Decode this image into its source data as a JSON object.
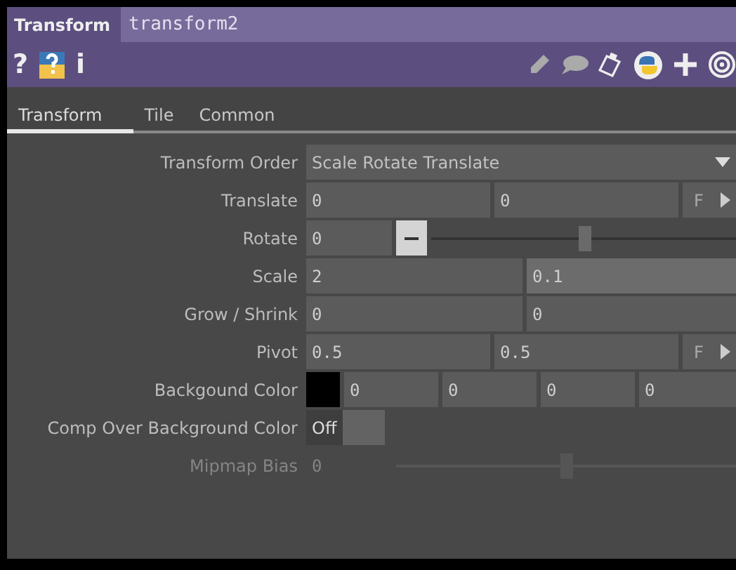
{
  "header": {
    "op_type": "Transform",
    "node_name": "transform2",
    "help_glyph": "?",
    "info_glyph": "i"
  },
  "tabs": [
    {
      "label": "Transform",
      "selected": true
    },
    {
      "label": "Tile",
      "selected": false
    },
    {
      "label": "Common",
      "selected": false
    }
  ],
  "params": [
    {
      "kind": "menu",
      "label": "Transform Order",
      "value": "Scale Rotate Translate",
      "disabled": false
    },
    {
      "kind": "fields",
      "label": "Translate",
      "values": [
        {
          "text": "0",
          "highlighted": false
        },
        {
          "text": "0",
          "highlighted": false
        }
      ],
      "extra": "F",
      "disabled": false
    },
    {
      "kind": "slider",
      "label": "Rotate",
      "value": "0",
      "level": 0.5,
      "disabled": false
    },
    {
      "kind": "fields",
      "label": "Scale",
      "values": [
        {
          "text": "2",
          "highlighted": false
        },
        {
          "text": "0.1",
          "highlighted": true
        }
      ],
      "disabled": false
    },
    {
      "kind": "fields",
      "label": "Grow / Shrink",
      "values": [
        {
          "text": "0",
          "highlighted": false
        },
        {
          "text": "0",
          "highlighted": false
        }
      ],
      "disabled": false
    },
    {
      "kind": "fields",
      "label": "Pivot",
      "values": [
        {
          "text": "0.5",
          "highlighted": false
        },
        {
          "text": "0.5",
          "highlighted": false
        }
      ],
      "extra": "F",
      "disabled": false
    },
    {
      "kind": "color",
      "label": "Backgound Color",
      "color": "#000000",
      "values": [
        {
          "text": "0",
          "highlighted": false
        },
        {
          "text": "0",
          "highlighted": false
        },
        {
          "text": "0",
          "highlighted": false
        },
        {
          "text": "0",
          "highlighted": false
        }
      ],
      "disabled": false
    },
    {
      "kind": "toggle",
      "label": "Comp Over Background Color",
      "value": "Off",
      "on": false,
      "disabled": false
    },
    {
      "kind": "slider",
      "label": "Mipmap Bias",
      "value": "0",
      "level": 0.5,
      "disabled": true
    }
  ]
}
